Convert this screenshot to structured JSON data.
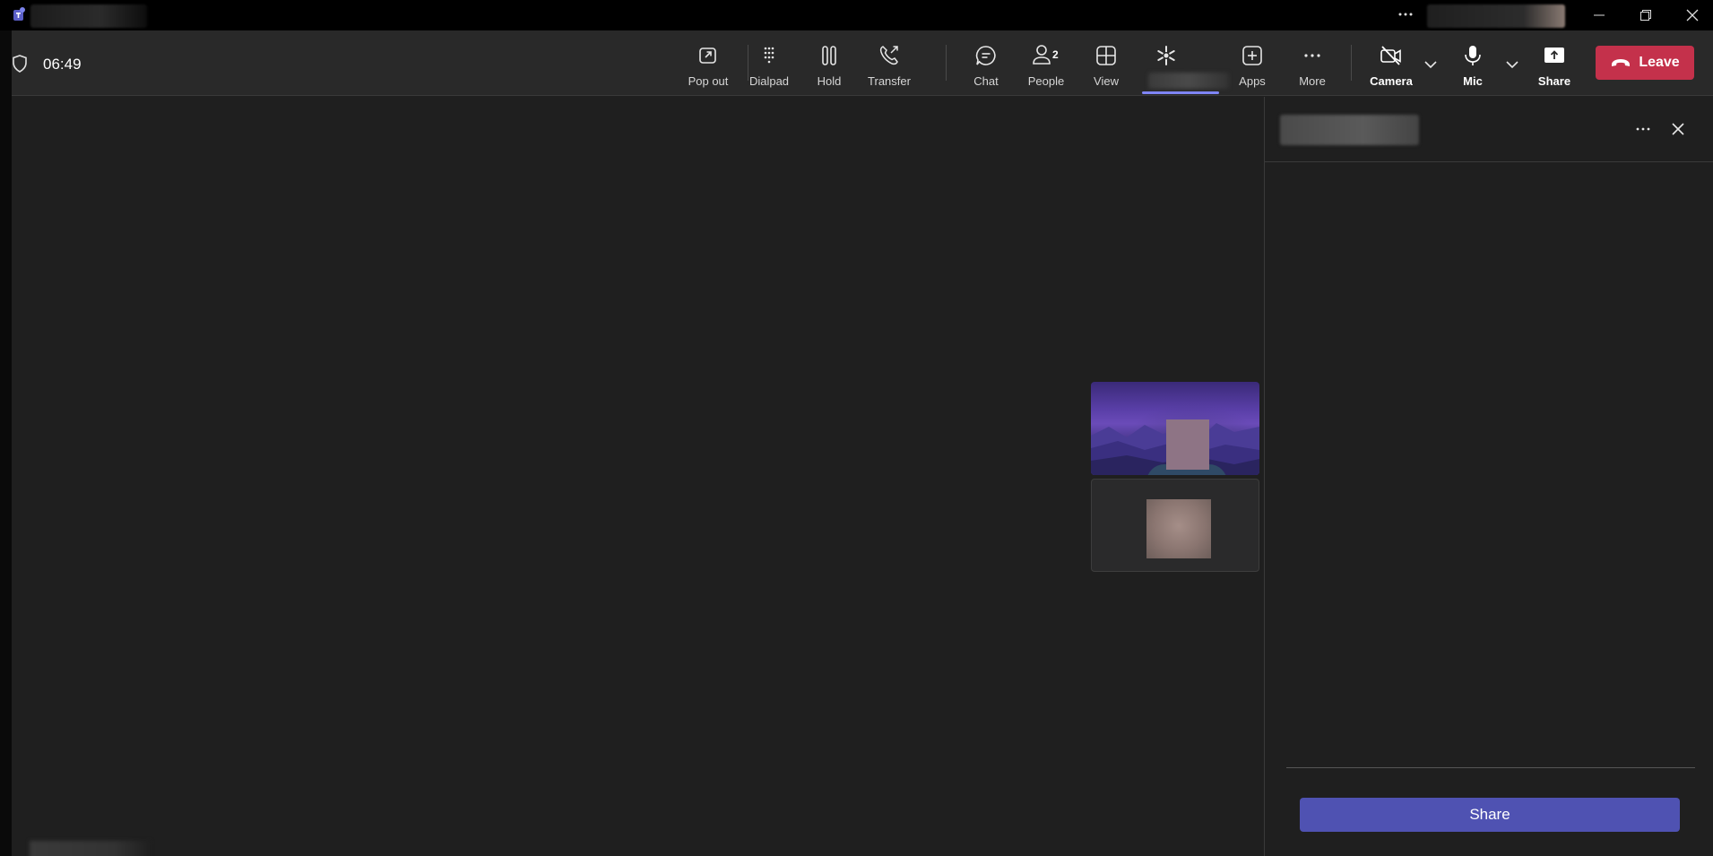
{
  "window": {
    "app_icon": "teams-logo-icon",
    "controls": [
      "minimize-icon",
      "restore-icon",
      "close-icon"
    ]
  },
  "toolbar": {
    "timer": "06:49",
    "buttons": {
      "pop_out": "Pop out",
      "dialpad": "Dialpad",
      "hold": "Hold",
      "transfer": "Transfer",
      "chat": "Chat",
      "people": "People",
      "people_count": "2",
      "view": "View",
      "apps": "Apps",
      "more": "More",
      "camera": "Camera",
      "mic": "Mic",
      "share": "Share"
    },
    "leave_label": "Leave"
  },
  "panel": {
    "share_button": "Share"
  },
  "colors": {
    "leave": "#c4314b",
    "share": "#4f52b2",
    "accent_underline": "#7f85f5",
    "background": "#1f1f1f"
  }
}
